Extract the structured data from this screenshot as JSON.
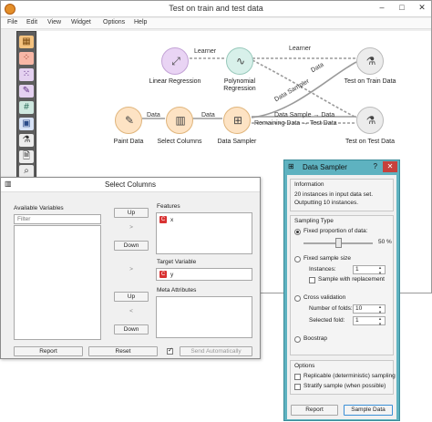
{
  "main_window": {
    "title": "Test on train and test data",
    "controls": {
      "minimize": "–",
      "maximize": "□",
      "close": "✕"
    },
    "menu": [
      "File",
      "Edit",
      "View",
      "Widget",
      "Options",
      "Help"
    ]
  },
  "toolbox": {
    "icons": [
      "data-table-icon",
      "scatter-icon",
      "scatter-dots-icon",
      "paint-icon",
      "grid-icon",
      "box-icon",
      "flask-icon",
      "file-icon",
      "search-icon"
    ]
  },
  "workflow": {
    "nodes": {
      "linear_regression": "Linear Regression",
      "polynomial_regression": "Polynomial\nRegression",
      "test_on_train": "Test on Train Data",
      "paint_data": "Paint Data",
      "select_columns": "Select Columns",
      "data_sampler": "Data Sampler",
      "test_on_test": "Test on Test Data"
    },
    "links": {
      "learner_1": "Learner",
      "learner_2": "Learner",
      "data_diag": "Data",
      "sampler_diag": "Data Sampler",
      "data_1": "Data",
      "data_2": "Data",
      "ds_data": "Data Sample → Data",
      "remaining": "Remaining Data → Test Data"
    }
  },
  "select_columns": {
    "title": "Select Columns",
    "available_label": "Available Variables",
    "filter_placeholder": "Filter",
    "features_label": "Features",
    "features": [
      {
        "badge": "C",
        "name": "x"
      }
    ],
    "target_label": "Target Variable",
    "target": [
      {
        "badge": "C",
        "name": "y"
      }
    ],
    "meta_label": "Meta Attributes",
    "buttons": {
      "up1": "Up",
      "move1": ">",
      "down1": "Down",
      "move2": ">",
      "up2": "Up",
      "move3": "<",
      "down2": "Down",
      "report": "Report",
      "reset": "Reset",
      "send_auto": "Send Automatically"
    }
  },
  "data_sampler": {
    "title": "Data Sampler",
    "help": "?",
    "close": "✕",
    "information_title": "Information",
    "info_line1": "20 instances in input data set.",
    "info_line2": "Outputting 10 instances.",
    "sampling_title": "Sampling Type",
    "fixed_proportion": "Fixed proportion of data:",
    "proportion": 50,
    "proportion_text": "50 %",
    "fixed_size": "Fixed sample size",
    "instances_label": "Instances:",
    "instances": "1",
    "with_replacement": "Sample with replacement",
    "cross_validation": "Cross validation",
    "folds_label": "Number of folds:",
    "folds": "10",
    "selected_fold_label": "Selected fold:",
    "selected_fold": "1",
    "bootstrap": "Boostrap",
    "options_title": "Options",
    "replicable": "Replicable (deterministic) sampling",
    "stratify": "Stratify sample (when possible)",
    "report": "Report",
    "sample_data": "Sample Data"
  },
  "colors": {
    "learner_node": "#e9d4f4",
    "data_node": "#fde3c4",
    "evaluate_node": "#d8f0ea",
    "sampler_frame": "#5eb2c0",
    "badge_red": "#d93232"
  }
}
